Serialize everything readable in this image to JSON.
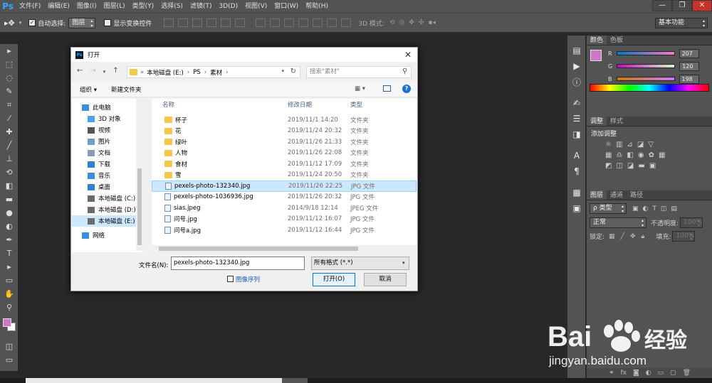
{
  "app": {
    "logo": "Ps",
    "menus": [
      "文件(F)",
      "编辑(E)",
      "图像(I)",
      "图层(L)",
      "类型(Y)",
      "选择(S)",
      "滤镜(T)",
      "3D(D)",
      "视图(V)",
      "窗口(W)",
      "帮助(H)"
    ],
    "window_controls": {
      "min": "—",
      "restore": "❐",
      "close": "✕"
    }
  },
  "options_bar": {
    "auto_select_label": "自动选择:",
    "auto_select_value": "图层",
    "show_transform_label": "显示变换控件",
    "mode_3d_label": "3D 模式:",
    "workspace_value": "基本功能"
  },
  "panels": {
    "color": {
      "tabs": [
        "颜色",
        "色板"
      ],
      "r_label": "R",
      "g_label": "G",
      "b_label": "B",
      "r_value": "207",
      "g_value": "120",
      "b_value": "198",
      "swatch_color": "#cf78c6"
    },
    "adjust": {
      "tabs": [
        "调整",
        "样式"
      ],
      "add_label": "添加调整"
    },
    "layers": {
      "tabs": [
        "图层",
        "通道",
        "路径"
      ],
      "kind_label": "ρ 类型",
      "blend_value": "正常",
      "opacity_label": "不透明度:",
      "opacity_value": "100%",
      "lock_label": "锁定:",
      "fill_label": "填充:",
      "fill_value": "100%"
    }
  },
  "dialog": {
    "title": "打开",
    "breadcrumb": [
      "«",
      "本地磁盘 (E:)",
      "PS",
      "素材"
    ],
    "search_placeholder": "搜索\"素材\"",
    "organize_label": "组织 ▾",
    "new_folder_label": "新建文件夹",
    "nav_items": [
      {
        "label": "此电脑",
        "color": "#3c8ee0"
      },
      {
        "label": "3D 对象",
        "color": "#4aa3e8"
      },
      {
        "label": "视频",
        "color": "#555"
      },
      {
        "label": "图片",
        "color": "#6a9ccf"
      },
      {
        "label": "文档",
        "color": "#8a9bb0"
      },
      {
        "label": "下载",
        "color": "#2f7fd8"
      },
      {
        "label": "音乐",
        "color": "#3c8ee0"
      },
      {
        "label": "桌面",
        "color": "#2f7fd8"
      },
      {
        "label": "本地磁盘 (C:)",
        "color": "#6b6b6b"
      },
      {
        "label": "本地磁盘 (D:)",
        "color": "#6b6b6b"
      },
      {
        "label": "本地磁盘 (E:)",
        "color": "#6b6b6b"
      },
      {
        "label": "网络",
        "color": "#3c8ee0"
      }
    ],
    "columns": [
      "名称",
      "修改日期",
      "类型"
    ],
    "files": [
      {
        "name": "杯子",
        "date": "2019/11/1 14:20",
        "type": "文件夹",
        "kind": "folder"
      },
      {
        "name": "花",
        "date": "2019/11/24 20:32",
        "type": "文件夹",
        "kind": "folder"
      },
      {
        "name": "绿叶",
        "date": "2019/11/26 21:33",
        "type": "文件夹",
        "kind": "folder"
      },
      {
        "name": "人物",
        "date": "2019/11/26 22:08",
        "type": "文件夹",
        "kind": "folder"
      },
      {
        "name": "食材",
        "date": "2019/11/12 17:09",
        "type": "文件夹",
        "kind": "folder"
      },
      {
        "name": "雪",
        "date": "2019/11/24 20:50",
        "type": "文件夹",
        "kind": "folder"
      },
      {
        "name": "pexels-photo-132340.jpg",
        "date": "2019/11/26 22:25",
        "type": "JPG 文件",
        "kind": "image"
      },
      {
        "name": "pexels-photo-1036936.jpg",
        "date": "2019/11/26 20:32",
        "type": "JPG 文件",
        "kind": "image"
      },
      {
        "name": "sias.jpeg",
        "date": "2014/9/18 12:14",
        "type": "JPEG 文件",
        "kind": "image"
      },
      {
        "name": "问号.jpg",
        "date": "2019/11/12 16:07",
        "type": "JPG 文件",
        "kind": "image"
      },
      {
        "name": "问号a.jpg",
        "date": "2019/11/12 16:44",
        "type": "JPG 文件",
        "kind": "image"
      }
    ],
    "filename_label": "文件名(N):",
    "filename_value": "pexels-photo-132340.jpg",
    "format_value": "所有格式 (*.*)",
    "image_sequence_label": "图像序列",
    "open_label": "打开(O)",
    "cancel_label": "取消"
  },
  "watermark": {
    "brand": "Bai",
    "brand2": "经验",
    "url": "jingyan.baidu.com"
  }
}
